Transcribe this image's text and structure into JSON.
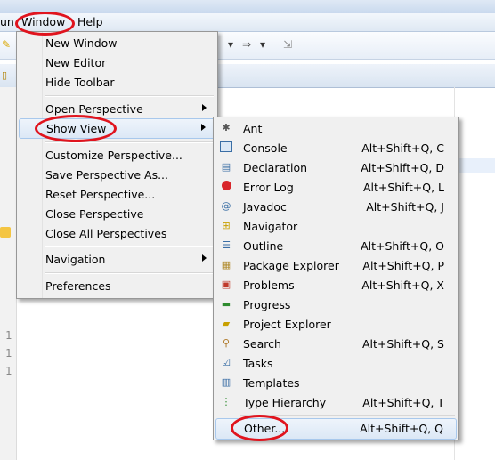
{
  "menubar": {
    "items": [
      {
        "label": "un"
      },
      {
        "label": "Window"
      },
      {
        "label": "Help"
      }
    ]
  },
  "gutter": {
    "line_numbers": [
      "1",
      "1",
      "1"
    ]
  },
  "window_menu": {
    "items": [
      {
        "label": "New Window"
      },
      {
        "label": "New Editor"
      },
      {
        "label": "Hide Toolbar"
      },
      {
        "label": "Open Perspective"
      },
      {
        "label": "Show View"
      },
      {
        "label": "Customize Perspective..."
      },
      {
        "label": "Save Perspective As..."
      },
      {
        "label": "Reset Perspective..."
      },
      {
        "label": "Close Perspective"
      },
      {
        "label": "Close All Perspectives"
      },
      {
        "label": "Navigation"
      },
      {
        "label": "Preferences"
      }
    ]
  },
  "show_view_menu": {
    "items": [
      {
        "label": "Ant",
        "shortcut": "",
        "icon": "ant-icon"
      },
      {
        "label": "Console",
        "shortcut": "Alt+Shift+Q, C",
        "icon": "console-icon"
      },
      {
        "label": "Declaration",
        "shortcut": "Alt+Shift+Q, D",
        "icon": "declaration-icon"
      },
      {
        "label": "Error Log",
        "shortcut": "Alt+Shift+Q, L",
        "icon": "error-log-icon"
      },
      {
        "label": "Javadoc",
        "shortcut": "Alt+Shift+Q, J",
        "icon": "javadoc-icon"
      },
      {
        "label": "Navigator",
        "shortcut": "",
        "icon": "navigator-icon"
      },
      {
        "label": "Outline",
        "shortcut": "Alt+Shift+Q, O",
        "icon": "outline-icon"
      },
      {
        "label": "Package Explorer",
        "shortcut": "Alt+Shift+Q, P",
        "icon": "package-explorer-icon"
      },
      {
        "label": "Problems",
        "shortcut": "Alt+Shift+Q, X",
        "icon": "problems-icon"
      },
      {
        "label": "Progress",
        "shortcut": "",
        "icon": "progress-icon"
      },
      {
        "label": "Project Explorer",
        "shortcut": "",
        "icon": "project-explorer-icon"
      },
      {
        "label": "Search",
        "shortcut": "Alt+Shift+Q, S",
        "icon": "search-icon"
      },
      {
        "label": "Tasks",
        "shortcut": "",
        "icon": "tasks-icon"
      },
      {
        "label": "Templates",
        "shortcut": "",
        "icon": "templates-icon"
      },
      {
        "label": "Type Hierarchy",
        "shortcut": "Alt+Shift+Q, T",
        "icon": "type-hierarchy-icon"
      },
      {
        "label": "Other...",
        "shortcut": "Alt+Shift+Q, Q",
        "icon": ""
      }
    ]
  },
  "colors": {
    "annotation": "#e0141e",
    "hover_border": "#a8c8ec",
    "menu_bg": "#f0f0f0"
  }
}
